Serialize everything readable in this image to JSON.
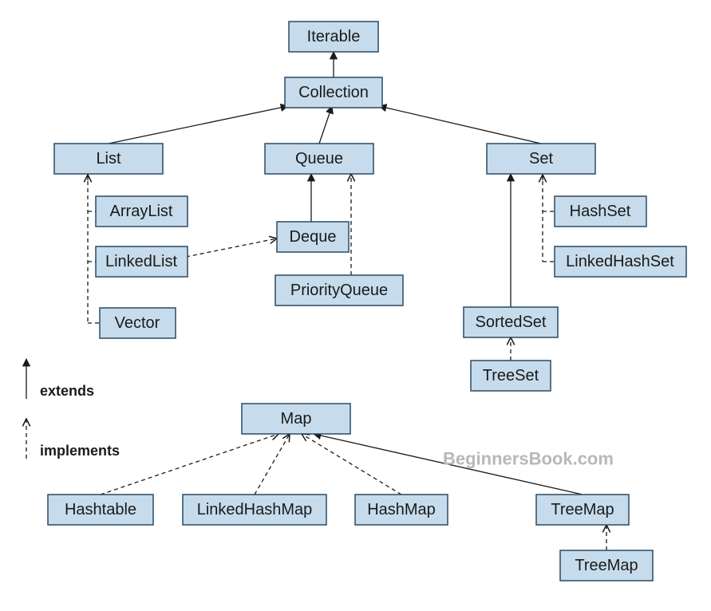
{
  "nodes": {
    "iterable": "Iterable",
    "collection": "Collection",
    "list": "List",
    "queue": "Queue",
    "set": "Set",
    "arraylist": "ArrayList",
    "linkedlist": "LinkedList",
    "vector": "Vector",
    "deque": "Deque",
    "priorityqueue": "PriorityQueue",
    "hashset": "HashSet",
    "linkedhashset": "LinkedHashSet",
    "sortedset": "SortedSet",
    "treeset": "TreeSet",
    "map": "Map",
    "hashtable": "Hashtable",
    "linkedhashmap": "LinkedHashMap",
    "hashmap": "HashMap",
    "treemap": "TreeMap",
    "treemap2": "TreeMap"
  },
  "legend": {
    "extends": "extends",
    "implements": "implements"
  },
  "watermark": "BeginnersBook.com"
}
